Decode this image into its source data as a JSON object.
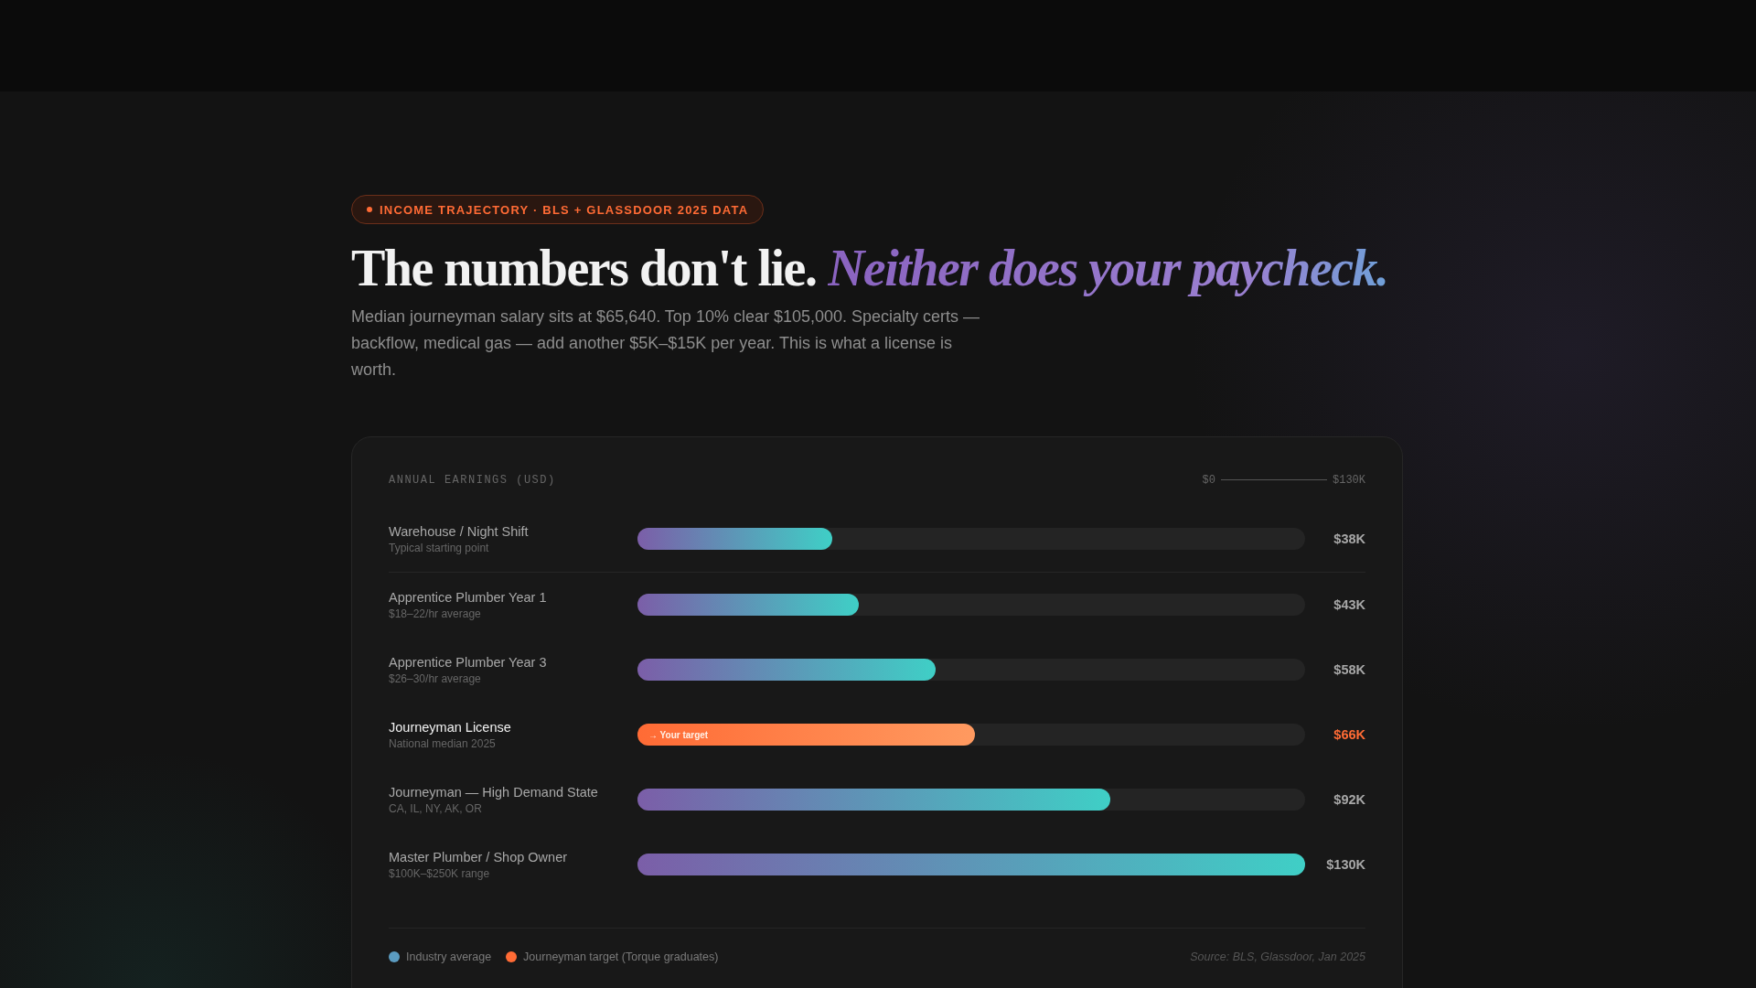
{
  "badge": "INCOME TRAJECTORY · BLS + GLASSDOOR 2025 DATA",
  "headline": {
    "plain": "The numbers don't lie.",
    "accent": "Neither does your paycheck."
  },
  "intro": "Median journeyman salary sits at $65,640. Top 10% clear $105,000. Specialty certs — backflow, medical gas — add another $5K–$15K per year. This is what a license is worth.",
  "card": {
    "title": "ANNUAL EARNINGS (USD)",
    "scale_min": "$0",
    "scale_max": "$130K",
    "rows": [
      {
        "label": "Warehouse / Night Shift",
        "sublabel": "Typical starting point",
        "kind": "average",
        "level": 0.292,
        "value": "$38K"
      },
      {
        "label": "Apprentice Plumber Year 1",
        "sublabel": "$18–22/hr average",
        "kind": "average",
        "level": 0.331,
        "value": "$43K"
      },
      {
        "label": "Apprentice Plumber Year 3",
        "sublabel": "$26–30/hr average",
        "kind": "average",
        "level": 0.447,
        "value": "$58K"
      },
      {
        "label": "Journeyman License",
        "sublabel": "National median 2025",
        "kind": "target",
        "level": 0.505,
        "value": "$66K",
        "bar_label": "→ Your target"
      },
      {
        "label": "Journeyman — High Demand State",
        "sublabel": "CA, IL, NY, AK, OR",
        "kind": "average",
        "level": 0.708,
        "value": "$92K"
      },
      {
        "label": "Master Plumber / Shop Owner",
        "sublabel": "$100K–$250K range",
        "kind": "average",
        "level": 1.0,
        "value": "$130K"
      }
    ],
    "legend": [
      {
        "label": "Industry average",
        "color": "#5b9bc0"
      },
      {
        "label": "Journeyman target (Torque graduates)",
        "color": "#ff6b35"
      }
    ],
    "source": "Source: BLS, Glassdoor, Jan 2025"
  }
}
